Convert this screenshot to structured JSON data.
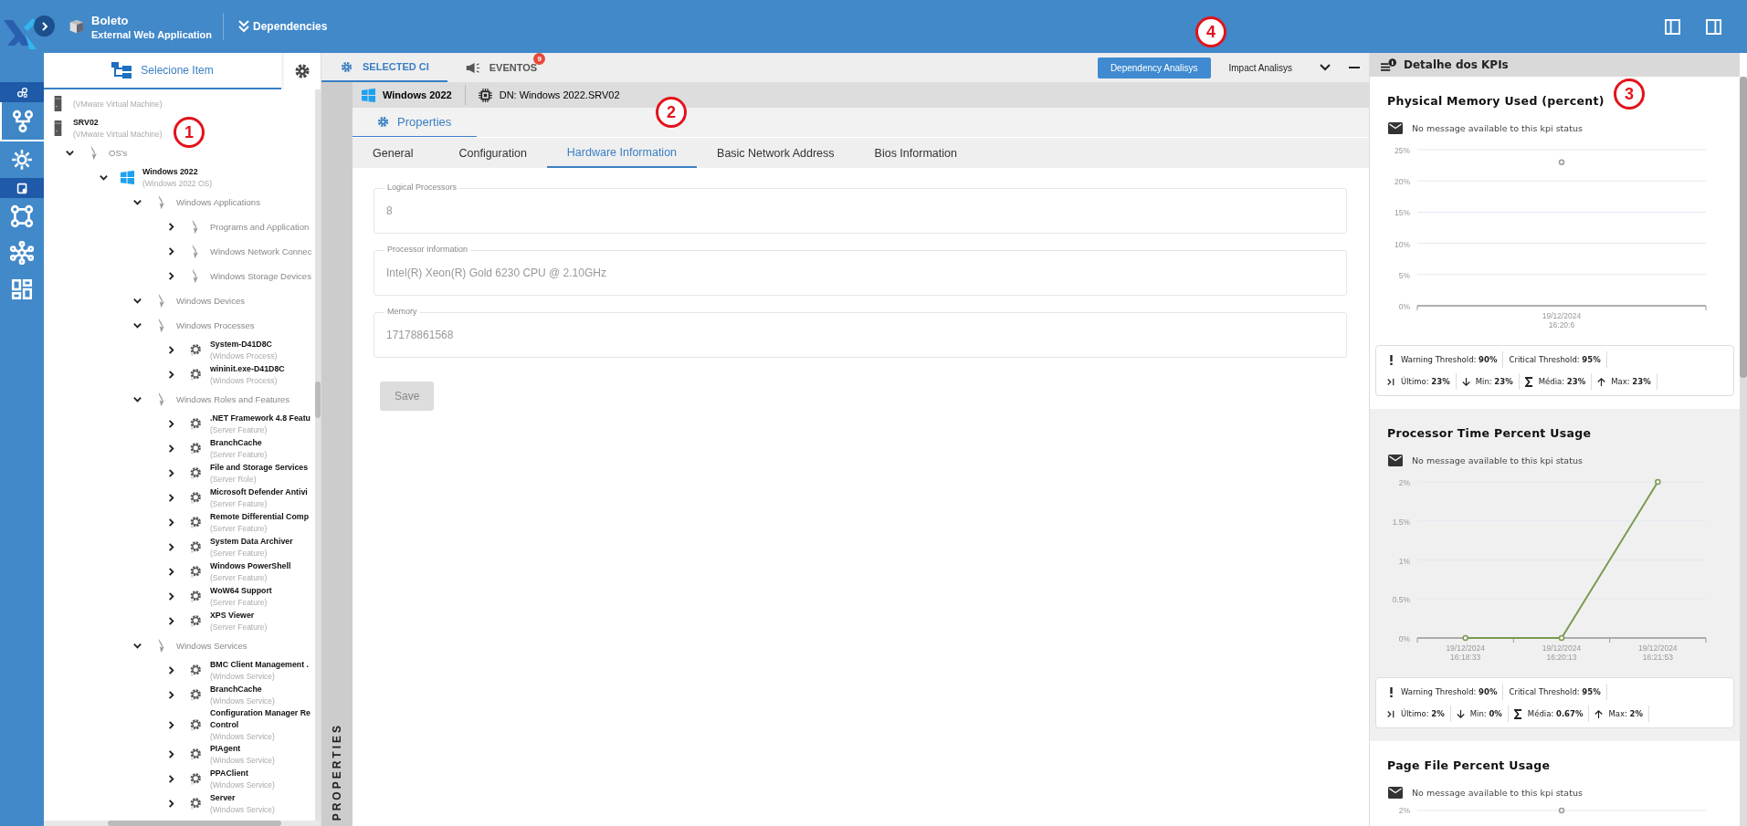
{
  "topbar": {
    "app_title": "Boleto",
    "app_subtitle": "External Web Application",
    "dependencies": "Dependencies"
  },
  "rail": [
    {
      "kind": "section"
    },
    {
      "kind": "item",
      "selected": true
    },
    {
      "kind": "item",
      "selected": false
    },
    {
      "kind": "section"
    },
    {
      "kind": "item",
      "selected": false
    },
    {
      "kind": "item",
      "selected": false
    },
    {
      "kind": "item",
      "selected": false
    }
  ],
  "tree_panel": {
    "tab": "Selecione Item"
  },
  "tree": [
    {
      "kind": "machine",
      "type": "(VMware Virtual Machine)"
    },
    {
      "kind": "machine",
      "name": "SRV02",
      "type": "(VMware Virtual Machine)",
      "children": [
        {
          "kind": "group",
          "name": "OS's",
          "expanded": true,
          "children": [
            {
              "kind": "os",
              "name": "Windows 2022",
              "type": "(Windows 2022 OS)",
              "expanded": true,
              "children": [
                {
                  "kind": "group",
                  "name": "Windows Applications",
                  "expanded": true,
                  "children": [
                    {
                      "kind": "group",
                      "name": "Programs and Application",
                      "expanded": false
                    },
                    {
                      "kind": "group",
                      "name": "Windows Network Connec",
                      "expanded": false
                    },
                    {
                      "kind": "group",
                      "name": "Windows Storage Devices",
                      "expanded": false
                    }
                  ]
                },
                {
                  "kind": "group",
                  "name": "Windows Devices",
                  "expanded": true
                },
                {
                  "kind": "group",
                  "name": "Windows Processes",
                  "expanded": true,
                  "children": [
                    {
                      "kind": "item",
                      "name": "System-D41D8C",
                      "type": "(Windows Process)",
                      "expanded": false
                    },
                    {
                      "kind": "item",
                      "name": "wininit.exe-D41D8C",
                      "type": "(Windows Process)",
                      "expanded": false
                    }
                  ]
                },
                {
                  "kind": "group",
                  "name": "Windows Roles and Features",
                  "expanded": true,
                  "children": [
                    {
                      "kind": "item",
                      "name": ".NET Framework 4.8 Featu",
                      "type": "(Server Feature)",
                      "expanded": false
                    },
                    {
                      "kind": "item",
                      "name": "BranchCache",
                      "type": "(Server Feature)",
                      "expanded": false
                    },
                    {
                      "kind": "item",
                      "name": "File and Storage Services",
                      "type": "(Server Role)",
                      "expanded": false
                    },
                    {
                      "kind": "item",
                      "name": "Microsoft Defender Antivi",
                      "type": "(Server Feature)",
                      "expanded": false
                    },
                    {
                      "kind": "item",
                      "name": "Remote Differential Comp",
                      "type": "(Server Feature)",
                      "expanded": false
                    },
                    {
                      "kind": "item",
                      "name": "System Data Archiver",
                      "type": "(Server Feature)",
                      "expanded": false
                    },
                    {
                      "kind": "item",
                      "name": "Windows PowerShell",
                      "type": "(Server Feature)",
                      "expanded": false
                    },
                    {
                      "kind": "item",
                      "name": "WoW64 Support",
                      "type": "(Server Feature)",
                      "expanded": false
                    },
                    {
                      "kind": "item",
                      "name": "XPS Viewer",
                      "type": "(Server Feature)",
                      "expanded": false
                    }
                  ]
                },
                {
                  "kind": "group",
                  "name": "Windows Services",
                  "expanded": true,
                  "children": [
                    {
                      "kind": "item",
                      "name": "BMC Client Management .",
                      "type": "(Windows Service)",
                      "expanded": false
                    },
                    {
                      "kind": "item",
                      "name": "BranchCache",
                      "type": "(Windows Service)",
                      "expanded": false
                    },
                    {
                      "kind": "item",
                      "name": "Configuration Manager Re\nControl",
                      "type": "(Windows Service)",
                      "expanded": false
                    },
                    {
                      "kind": "item",
                      "name": "PIAgent",
                      "type": "(Windows Service)",
                      "expanded": false
                    },
                    {
                      "kind": "item",
                      "name": "PPAClient",
                      "type": "(Windows Service)",
                      "expanded": false
                    },
                    {
                      "kind": "item",
                      "name": "Server",
                      "type": "(Windows Service)",
                      "expanded": false
                    }
                  ]
                }
              ]
            }
          ]
        }
      ]
    }
  ],
  "main_tabs": [
    {
      "label": "SELECTED CI",
      "selected": true
    },
    {
      "label": "EVENTOS",
      "selected": false,
      "badge": "9"
    }
  ],
  "actions": [
    {
      "label": "Dependency Analisys",
      "selected": true
    },
    {
      "label": "Impact Analisys",
      "selected": false
    }
  ],
  "ci_bar": {
    "name": "Windows 2022",
    "dn": "DN: Windows 2022.SRV02"
  },
  "section_tab": {
    "label": "Properties",
    "selected": true
  },
  "sub_tabs": [
    {
      "label": "General",
      "selected": false
    },
    {
      "label": "Configuration",
      "selected": false
    },
    {
      "label": "Hardware Information",
      "selected": true
    },
    {
      "label": "Basic Network Address",
      "selected": false
    },
    {
      "label": "Bios Information",
      "selected": false
    }
  ],
  "fields": [
    {
      "label": "Logical Processors",
      "value": "8",
      "disabled": true
    },
    {
      "label": "Processor Information",
      "value": "Intel(R) Xeon(R) Gold 6230 CPU @ 2.10GHz",
      "disabled": true
    },
    {
      "label": "Memory",
      "value": "17178861568",
      "disabled": true
    }
  ],
  "save_button": {
    "label": "Save",
    "disabled": true
  },
  "side_label": "PROPERTIES",
  "kpi_panel": {
    "title": "Detalhe dos KPIs",
    "cards": [
      {
        "title": "Physical Memory Used (percent)",
        "highlighted": false,
        "message": "No message available to this kpi status",
        "chart_data": {
          "type": "scatter",
          "categories": [
            "19/12/2024 16:20:6"
          ],
          "grid": true,
          "series": [
            {
              "color": "#9a9a9a",
              "marker": true,
              "values": [
                23
              ]
            }
          ],
          "ylim": [
            0,
            25
          ],
          "yticks": [
            {
              "value": 0,
              "label": "0%"
            },
            {
              "value": 5,
              "label": "5%"
            },
            {
              "value": 10,
              "label": "10%"
            },
            {
              "value": 15,
              "label": "15%"
            },
            {
              "value": 20,
              "label": "20%"
            },
            {
              "value": 25,
              "label": "25%"
            }
          ]
        },
        "stat_rows": [
          [
            {
              "kind": "warning",
              "text": "Warning Threshold: **90%**"
            },
            {
              "kind": "critical",
              "text": "Critical Threshold: **95%**"
            }
          ],
          [
            {
              "kind": "last",
              "text": "Último: **23%**"
            },
            {
              "kind": "min",
              "text": "Min: **23%**"
            },
            {
              "kind": "avg",
              "text": "Média: **23%**"
            },
            {
              "kind": "max",
              "text": "Max: **23%**"
            }
          ]
        ]
      },
      {
        "title": "Processor Time Percent Usage",
        "highlighted": true,
        "message": "No message available to this kpi status",
        "chart_data": {
          "type": "line",
          "categories": [
            "19/12/2024 16:18:33",
            "19/12/2024 16:20:13",
            "19/12/2024 16:21:53"
          ],
          "grid": true,
          "series": [
            {
              "color": "#7a9a50",
              "marker": true,
              "values": [
                0,
                0,
                2
              ]
            }
          ],
          "ylim": [
            0,
            2
          ],
          "yticks": [
            {
              "value": 0,
              "label": "0%"
            },
            {
              "value": 0.5,
              "label": "0.5%"
            },
            {
              "value": 1,
              "label": "1%"
            },
            {
              "value": 1.5,
              "label": "1.5%"
            },
            {
              "value": 2,
              "label": "2%"
            }
          ]
        },
        "stat_rows": [
          [
            {
              "kind": "warning",
              "text": "Warning Threshold: **90%**"
            },
            {
              "kind": "critical",
              "text": "Critical Threshold: **95%**"
            }
          ],
          [
            {
              "kind": "last",
              "text": "Último: **2%**"
            },
            {
              "kind": "min",
              "text": "Min: **0%**"
            },
            {
              "kind": "avg",
              "text": "Média: **0.67%**"
            },
            {
              "kind": "max",
              "text": "Max: **2%**"
            }
          ]
        ]
      },
      {
        "title": "Page File Percent Usage",
        "highlighted": false,
        "message": "No message available to this kpi status",
        "partial_tick": "2%"
      }
    ]
  },
  "annotations": [
    "1",
    "2",
    "3",
    "4"
  ]
}
